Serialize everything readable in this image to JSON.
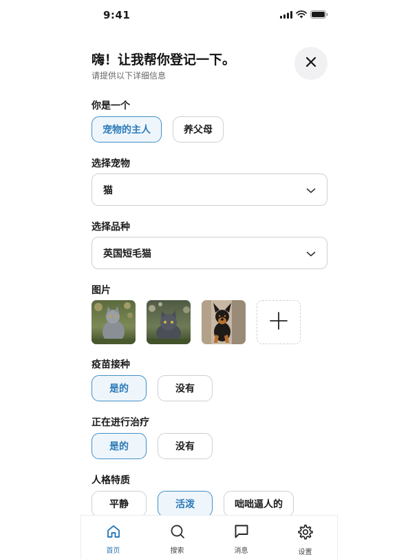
{
  "status_bar": {
    "time": "9:41"
  },
  "header": {
    "title": "嗨！让我帮你登记一下。",
    "subtitle": "请提供以下详细信息",
    "close_icon": "close-icon"
  },
  "role": {
    "label": "你是一个",
    "options": [
      {
        "label": "宠物的主人",
        "selected": true
      },
      {
        "label": "养父母",
        "selected": false
      }
    ]
  },
  "pet": {
    "label": "选择宠物",
    "value": "猫"
  },
  "breed": {
    "label": "选择品种",
    "value": "英国短毛猫"
  },
  "photos": {
    "label": "图片",
    "items": [
      "gray-cat-photo",
      "dark-cat-photo",
      "puppy-photo"
    ],
    "add_icon": "plus-icon"
  },
  "vaccinated": {
    "label": "疫苗接种",
    "options": [
      {
        "label": "是的",
        "selected": true
      },
      {
        "label": "没有",
        "selected": false
      }
    ]
  },
  "treatment": {
    "label": "正在进行治疗",
    "options": [
      {
        "label": "是的",
        "selected": true
      },
      {
        "label": "没有",
        "selected": false
      }
    ]
  },
  "personality": {
    "label": "人格特质",
    "options": [
      {
        "label": "平静",
        "selected": false
      },
      {
        "label": "活泼",
        "selected": true
      },
      {
        "label": "咄咄逼人的",
        "selected": false
      }
    ]
  },
  "tab_bar": {
    "items": [
      {
        "label": "首页",
        "icon": "home-icon",
        "active": true
      },
      {
        "label": "搜索",
        "icon": "search-icon",
        "active": false
      },
      {
        "label": "消息",
        "icon": "message-icon",
        "active": false
      },
      {
        "label": "设置",
        "icon": "gear-icon",
        "active": false
      }
    ]
  },
  "colors": {
    "accent": "#2c7ab8",
    "accent_bg": "#eef6fc",
    "border": "#cfcfd4"
  }
}
